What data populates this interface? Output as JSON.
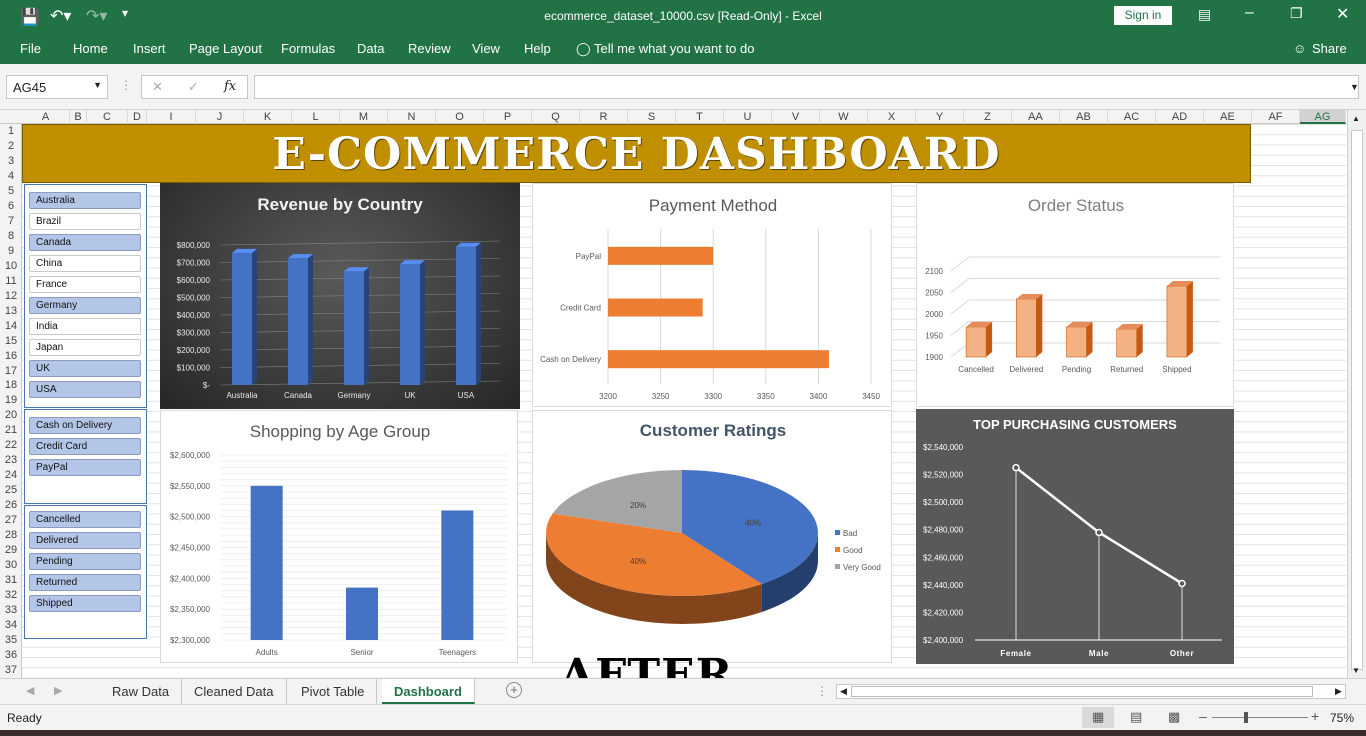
{
  "window": {
    "title": "ecommerce_dataset_10000.csv  [Read-Only]  -  Excel",
    "sign_in": "Sign in",
    "share": "Share",
    "tell_me": "Tell me what you want to do"
  },
  "menu": [
    "File",
    "Home",
    "Insert",
    "Page Layout",
    "Formulas",
    "Data",
    "Review",
    "View",
    "Help"
  ],
  "formula_bar": {
    "name_box": "AG45",
    "fx": "fx",
    "formula": ""
  },
  "columns": [
    "A",
    "B",
    "C",
    "D",
    "I",
    "J",
    "K",
    "L",
    "M",
    "N",
    "O",
    "P",
    "Q",
    "R",
    "S",
    "T",
    "U",
    "V",
    "W",
    "X",
    "Y",
    "Z",
    "AA",
    "AB",
    "AC",
    "AD",
    "AE",
    "AF",
    "AG"
  ],
  "rows": [
    "1",
    "2",
    "3",
    "4",
    "5",
    "6",
    "7",
    "8",
    "9",
    "10",
    "11",
    "12",
    "13",
    "14",
    "15",
    "16",
    "17",
    "18",
    "19",
    "20",
    "21",
    "22",
    "23",
    "24",
    "25",
    "26",
    "27",
    "28",
    "29",
    "30",
    "31",
    "32",
    "33",
    "34",
    "35",
    "36",
    "37"
  ],
  "banner": "E-COMMERCE DASHBOARD",
  "slicers": {
    "country": [
      {
        "label": "Australia",
        "selected": true
      },
      {
        "label": "Brazil",
        "selected": false
      },
      {
        "label": "Canada",
        "selected": true
      },
      {
        "label": "China",
        "selected": false
      },
      {
        "label": "France",
        "selected": false
      },
      {
        "label": "Germany",
        "selected": true
      },
      {
        "label": "India",
        "selected": false
      },
      {
        "label": "Japan",
        "selected": false
      },
      {
        "label": "UK",
        "selected": true
      },
      {
        "label": "USA",
        "selected": true
      }
    ],
    "payment": [
      {
        "label": "Cash on Delivery",
        "selected": true
      },
      {
        "label": "Credit Card",
        "selected": true
      },
      {
        "label": "PayPal",
        "selected": true
      }
    ],
    "status": [
      {
        "label": "Cancelled",
        "selected": true
      },
      {
        "label": "Delivered",
        "selected": true
      },
      {
        "label": "Pending",
        "selected": true
      },
      {
        "label": "Returned",
        "selected": true
      },
      {
        "label": "Shipped",
        "selected": true
      }
    ]
  },
  "chart_data": [
    {
      "id": "revenue",
      "type": "bar",
      "title": "Revenue by Country",
      "categories": [
        "Australia",
        "Canada",
        "Germany",
        "UK",
        "USA"
      ],
      "values": [
        755000,
        725000,
        650000,
        690000,
        790000
      ],
      "ylim": [
        0,
        800000
      ],
      "yticks": [
        "$-",
        "$100,000",
        "$200,000",
        "$300,000",
        "$400,000",
        "$500,000",
        "$600,000",
        "$700,000",
        "$800,000"
      ],
      "color": "#4472c4"
    },
    {
      "id": "payment",
      "type": "bar",
      "orientation": "horizontal",
      "title": "Payment Method",
      "categories": [
        "PayPal",
        "Credit Card",
        "Cash on Delivery"
      ],
      "values": [
        3300,
        3290,
        3410
      ],
      "xlim": [
        3200,
        3450
      ],
      "xticks": [
        "3200",
        "3250",
        "3300",
        "3350",
        "3400",
        "3450"
      ],
      "color": "#ed7d31"
    },
    {
      "id": "status",
      "type": "bar",
      "title": "Order Status",
      "categories": [
        "Cancelled",
        "Delivered",
        "Pending",
        "Returned",
        "Shipped"
      ],
      "values": [
        1970,
        2035,
        1970,
        1965,
        2065
      ],
      "ylim": [
        1900,
        2100
      ],
      "yticks": [
        "1900",
        "1950",
        "2000",
        "2050",
        "2100"
      ],
      "color": "#f4b183"
    },
    {
      "id": "age",
      "type": "bar",
      "title": "Shopping by Age Group",
      "categories": [
        "Adults",
        "Senior",
        "Teenagers"
      ],
      "values": [
        2550000,
        2385000,
        2510000
      ],
      "ylim": [
        2300000,
        2600000
      ],
      "yticks": [
        "$2,300,000",
        "$2,350,000",
        "$2,400,000",
        "$2,450,000",
        "$2,500,000",
        "$2,550,000",
        "$2,600,000"
      ],
      "color": "#4472c4"
    },
    {
      "id": "ratings",
      "type": "pie",
      "title": "Customer Ratings",
      "labels": [
        "Bad",
        "Good",
        "Very Good"
      ],
      "values": [
        40,
        40,
        20
      ],
      "value_labels": [
        "40%",
        "40%",
        "20%"
      ],
      "colors": [
        "#4472c4",
        "#ed7d31",
        "#a5a5a5"
      ]
    },
    {
      "id": "customers",
      "type": "line",
      "title": "TOP PURCHASING CUSTOMERS",
      "categories": [
        "Female",
        "Male",
        "Other"
      ],
      "values": [
        2525000,
        2478000,
        2441000
      ],
      "ylim": [
        2400000,
        2540000
      ],
      "yticks": [
        "$2,400,000",
        "$2,420,000",
        "$2,440,000",
        "$2,460,000",
        "$2,480,000",
        "$2,500,000",
        "$2,520,000",
        "$2,540,000"
      ],
      "color": "#ffffff"
    }
  ],
  "after_label": "AFTER",
  "sheet_tabs": [
    {
      "label": "Raw Data",
      "active": false
    },
    {
      "label": "Cleaned Data",
      "active": false
    },
    {
      "label": "Pivot Table",
      "active": false
    },
    {
      "label": "Dashboard",
      "active": true
    }
  ],
  "status": {
    "ready": "Ready",
    "zoom": "75%"
  }
}
